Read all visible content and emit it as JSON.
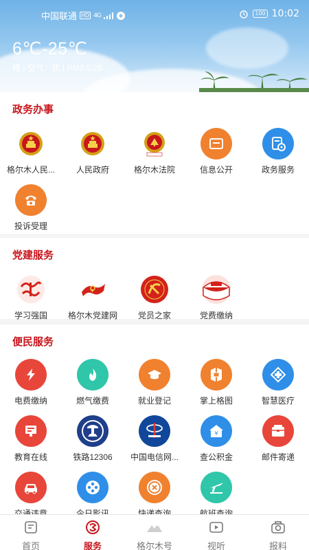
{
  "status": {
    "carrier": "中国联通",
    "hd": "HD",
    "signal": "4G",
    "battery": "100",
    "time": "10:02"
  },
  "weather": {
    "temp": "6℃-25℃",
    "desc": "晴 | 空气：优 | PM2.5:26"
  },
  "sections": [
    {
      "title": "政务办事",
      "items": [
        {
          "label": "格尔木人民...",
          "icon": "national-emblem-icon"
        },
        {
          "label": "人民政府",
          "icon": "national-emblem-icon"
        },
        {
          "label": "格尔木法院",
          "icon": "court-emblem-icon"
        },
        {
          "label": "信息公开",
          "icon": "info-icon"
        },
        {
          "label": "政务服务",
          "icon": "service-icon"
        },
        {
          "label": "投诉受理",
          "icon": "phone-icon"
        }
      ]
    },
    {
      "title": "党建服务",
      "items": [
        {
          "label": "学习强国",
          "icon": "xuexi-icon"
        },
        {
          "label": "格尔木党建网",
          "icon": "party-flag-icon"
        },
        {
          "label": "党员之家",
          "icon": "party-emblem-icon"
        },
        {
          "label": "党费缴纳",
          "icon": "party-fee-icon"
        }
      ]
    },
    {
      "title": "便民服务",
      "items": [
        {
          "label": "电费缴纳",
          "icon": "lightning-icon"
        },
        {
          "label": "燃气缴费",
          "icon": "flame-icon"
        },
        {
          "label": "就业登记",
          "icon": "graduation-cap-icon"
        },
        {
          "label": "掌上格图",
          "icon": "library-icon"
        },
        {
          "label": "智慧医疗",
          "icon": "medical-icon"
        },
        {
          "label": "教育在线",
          "icon": "education-icon"
        },
        {
          "label": "铁路12306",
          "icon": "railway-icon"
        },
        {
          "label": "中国电信网...",
          "icon": "telecom-icon"
        },
        {
          "label": "查公积金",
          "icon": "housing-fund-icon"
        },
        {
          "label": "邮件寄递",
          "icon": "mail-icon"
        },
        {
          "label": "交通违章",
          "icon": "car-icon"
        },
        {
          "label": "今日影讯",
          "icon": "film-icon"
        },
        {
          "label": "快递查询",
          "icon": "express-icon"
        },
        {
          "label": "航班查询",
          "icon": "plane-icon"
        }
      ]
    }
  ],
  "nav": [
    {
      "label": "首页",
      "icon": "home-icon"
    },
    {
      "label": "服务",
      "icon": "service-nav-icon"
    },
    {
      "label": "格尔木号",
      "icon": "mountain-icon"
    },
    {
      "label": "视听",
      "icon": "video-icon"
    },
    {
      "label": "报料",
      "icon": "camera-icon"
    }
  ],
  "colors": {
    "accent": "#c8161d",
    "red_icon": "#e8463a",
    "orange_icon": "#f0812f",
    "teal_icon": "#2fc6a9",
    "blue_icon": "#2f8fe8"
  }
}
